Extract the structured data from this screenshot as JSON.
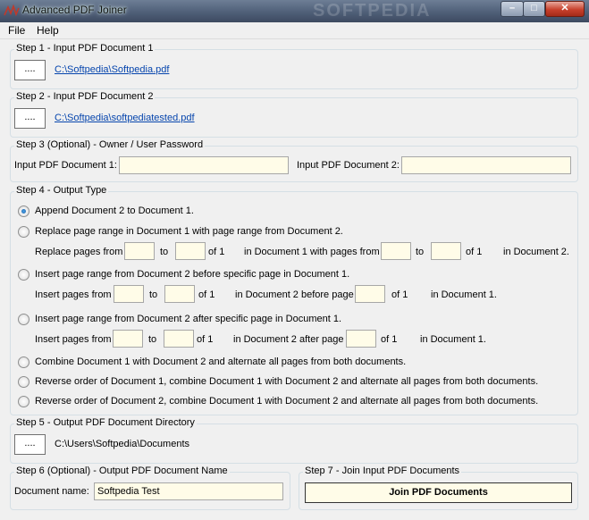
{
  "window": {
    "title": "Advanced PDF Joiner",
    "watermark": "SOFTPEDIA",
    "buttons": {
      "minimize": "–",
      "maximize": "□",
      "close": "✕"
    }
  },
  "menu": [
    "File",
    "Help"
  ],
  "step1": {
    "legend": "Step 1 - Input PDF Document 1",
    "browse_label": "....",
    "path": "C:\\Softpedia\\Softpedia.pdf"
  },
  "step2": {
    "legend": "Step 2 - Input PDF Document 2",
    "browse_label": "....",
    "path": "C:\\Softpedia\\softpediatested.pdf"
  },
  "step3": {
    "legend": "Step 3 (Optional) - Owner / User Password",
    "doc1_label": "Input PDF Document 1:",
    "doc1_value": "",
    "doc2_label": "Input PDF Document 2:",
    "doc2_value": ""
  },
  "step4": {
    "legend": "Step 4 - Output Type",
    "selected_option": 0,
    "options": [
      {
        "label": "Append Document 2 to Document 1."
      },
      {
        "label": "Replace page range in Document 1 with page range from Document 2."
      },
      {
        "label": "Insert page range from Document 2 before specific page in Document 1."
      },
      {
        "label": "Insert page range from Document 2 after specific page in Document 1."
      },
      {
        "label": "Combine Document 1 with Document 2 and alternate all pages from both documents."
      },
      {
        "label": "Reverse order of Document 1, combine Document 1 with Document 2 and alternate all pages from both documents."
      },
      {
        "label": "Reverse order of Document 2, combine Document 1 with Document 2 and alternate all pages from both documents."
      }
    ],
    "replace_row": {
      "prefix": "Replace pages from",
      "to1": "to",
      "of1": "of 1",
      "middle": "in Document 1 with pages from",
      "to2": "to",
      "of2": "of 1",
      "suffix": "in Document 2."
    },
    "before_row": {
      "prefix": "Insert pages from",
      "to": "to",
      "of1": "of 1",
      "middle": "in Document 2 before page",
      "of2": "of  1",
      "suffix": "in Document 1."
    },
    "after_row": {
      "prefix": "Insert pages from",
      "to": "to",
      "of1": "of 1",
      "middle": "in Document 2 after page",
      "of2": "of  1",
      "suffix": "in Document 1."
    }
  },
  "step5": {
    "legend": "Step 5 - Output PDF Document Directory",
    "browse_label": "....",
    "path": "C:\\Users\\Softpedia\\Documents"
  },
  "step6": {
    "legend": "Step 6 (Optional) - Output PDF Document Name",
    "name_label": "Document name:",
    "name_value": "Softpedia Test"
  },
  "step7": {
    "legend": "Step 7 - Join Input PDF Documents",
    "button_label": "Join PDF Documents"
  }
}
